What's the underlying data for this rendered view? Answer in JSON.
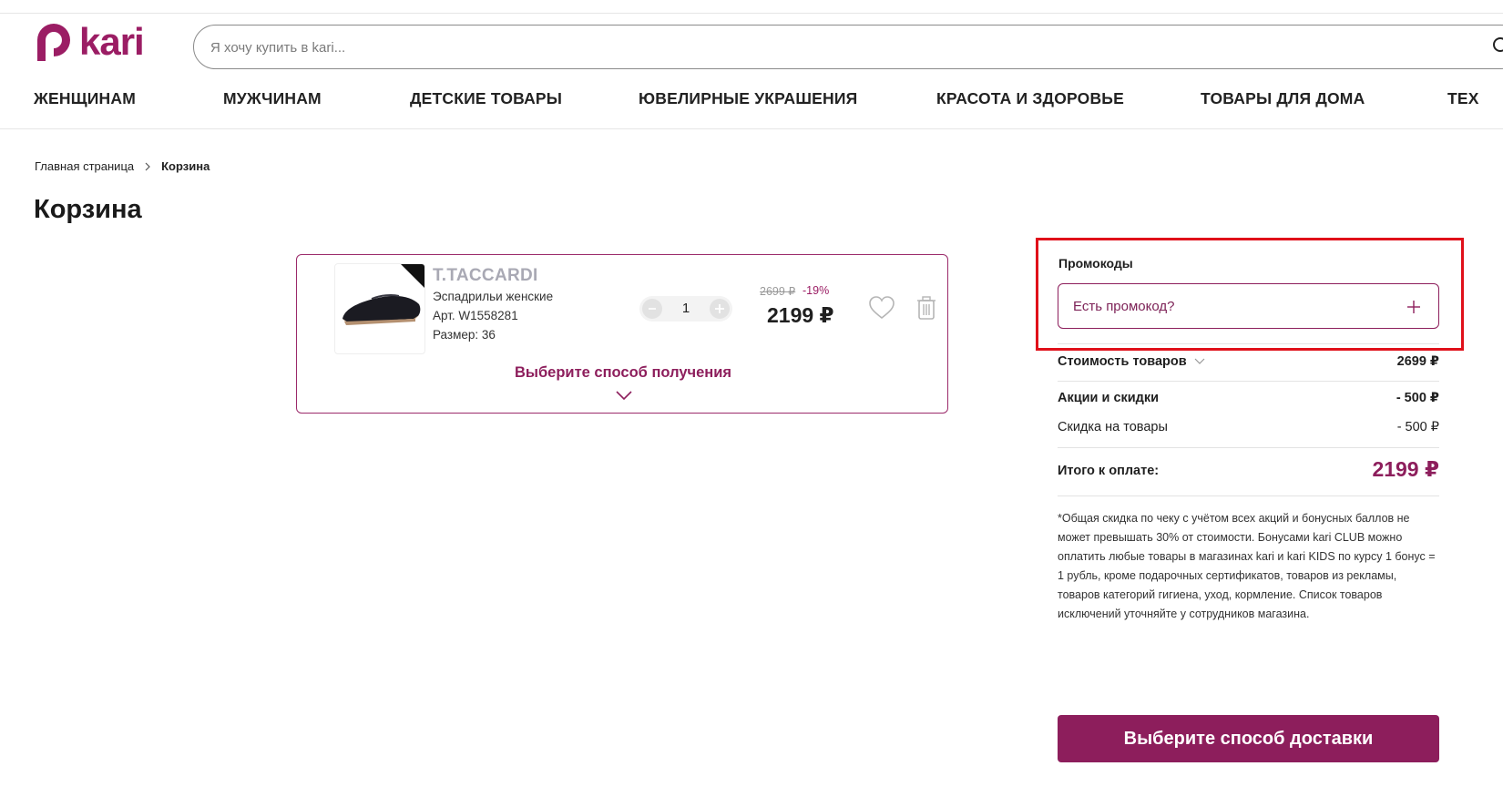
{
  "header": {
    "logo_text": "kari",
    "search_placeholder": "Я хочу купить в kari..."
  },
  "nav": [
    "ЖЕНЩИНАМ",
    "МУЖЧИНАМ",
    "ДЕТСКИЕ ТОВАРЫ",
    "ЮВЕЛИРНЫЕ УКРАШЕНИЯ",
    "КРАСОТА И ЗДОРОВЬЕ",
    "ТОВАРЫ ДЛЯ ДОМА",
    "ТЕХ"
  ],
  "breadcrumb": {
    "home": "Главная страница",
    "current": "Корзина"
  },
  "page_title": "Корзина",
  "cart_item": {
    "brand": "T.TACCARDI",
    "name": "Эспадрильи женские",
    "sku": "Арт. W1558281",
    "size": "Размер: 36",
    "quantity": "1",
    "old_price": "2699 ₽",
    "discount": "-19%",
    "price": "2199 ₽",
    "pickup_label": "Выберите способ получения"
  },
  "promo": {
    "title": "Промокоды",
    "placeholder": "Есть промокод?"
  },
  "summary": {
    "goods_label": "Стоимость товаров",
    "goods_value": "2699 ₽",
    "promos_label": "Акции и скидки",
    "promos_value": "- 500 ₽",
    "item_discount_label": "Скидка на товары",
    "item_discount_value": "- 500 ₽",
    "total_label": "Итого к оплате:",
    "total_value": "2199 ₽"
  },
  "disclaimer": "*Общая скидка по чеку с учётом всех акций и бонусных баллов не может превышать 30% от стоимости. Бонусами kari CLUB можно оплатить любые товары в магазинах kari и kari KIDS по курсу 1 бонус = 1 рубль, кроме подарочных сертификатов, товаров из рекламы, товаров категорий гигиена, уход, кормление. Список товаров исключений уточняйте у сотрудников магазина.",
  "cta_label": "Выберите способ доставки",
  "colors": {
    "brand": "#8d1e5c",
    "highlight": "#e0101a"
  },
  "icons": [
    "search-icon",
    "chevron-right-icon",
    "heart-icon",
    "trash-icon",
    "chevron-down-icon",
    "plus-icon",
    "minus-icon"
  ]
}
